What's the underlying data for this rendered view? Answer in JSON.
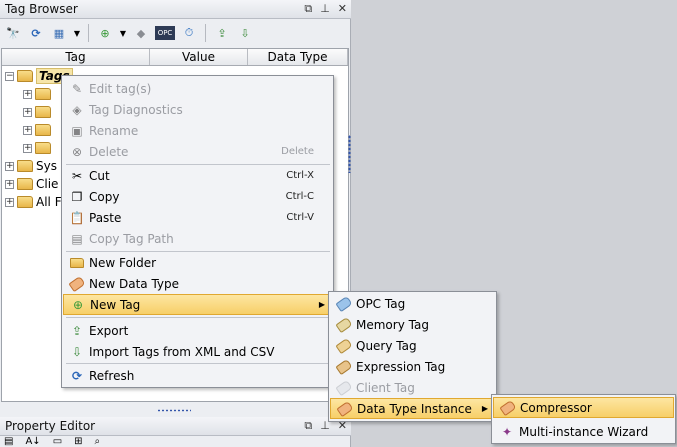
{
  "tag_browser": {
    "title": "Tag Browser",
    "columns": {
      "tag": "Tag",
      "value": "Value",
      "data_type": "Data Type"
    },
    "tree": {
      "root": "Tags",
      "sys": "Sys",
      "cli": "Clie",
      "all": "All F"
    }
  },
  "property_editor": {
    "title": "Property Editor"
  },
  "context_menu": {
    "edit_tags": "Edit tag(s)",
    "tag_diagnostics": "Tag Diagnostics",
    "rename": "Rename",
    "delete": "Delete",
    "delete_sc": "Delete",
    "cut": "Cut",
    "cut_sc": "Ctrl-X",
    "copy": "Copy",
    "copy_sc": "Ctrl-C",
    "paste": "Paste",
    "paste_sc": "Ctrl-V",
    "copy_tag_path": "Copy Tag Path",
    "new_folder": "New Folder",
    "new_data_type": "New Data Type",
    "new_tag": "New Tag",
    "export": "Export",
    "import_tags": "Import Tags from XML and CSV",
    "refresh": "Refresh"
  },
  "new_tag_menu": {
    "opc_tag": "OPC Tag",
    "memory_tag": "Memory Tag",
    "query_tag": "Query Tag",
    "expression_tag": "Expression Tag",
    "client_tag": "Client Tag",
    "data_type_instance": "Data Type Instance"
  },
  "dti_menu": {
    "compressor": "Compressor",
    "multi_instance_wizard": "Multi-instance Wizard"
  },
  "toolbar": {
    "opc_label": "OPC"
  }
}
